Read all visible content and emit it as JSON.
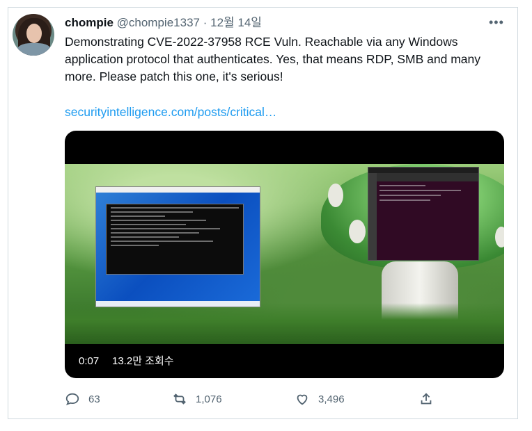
{
  "tweet": {
    "author_name": "chompie",
    "author_handle": "@chompie1337",
    "separator": "·",
    "date": "12월 14일",
    "more_label": "•••",
    "text": "Demonstrating CVE-2022-37958 RCE Vuln. Reachable via any Windows application protocol that authenticates. Yes, that means RDP, SMB and many more. Please patch this one, it's serious!",
    "link": "securityintelligence.com/posts/critical…"
  },
  "media": {
    "time": "0:07",
    "views": "13.2만 조회수"
  },
  "actions": {
    "reply_count": "63",
    "retweet_count": "1,076",
    "like_count": "3,496"
  },
  "icons": {
    "reply": "reply-icon",
    "retweet": "retweet-icon",
    "like": "heart-icon",
    "share": "share-icon",
    "more": "more-icon"
  },
  "colors": {
    "link": "#1d9bf0",
    "muted": "#536471",
    "text": "#0f1419",
    "border": "#cfd9de"
  }
}
